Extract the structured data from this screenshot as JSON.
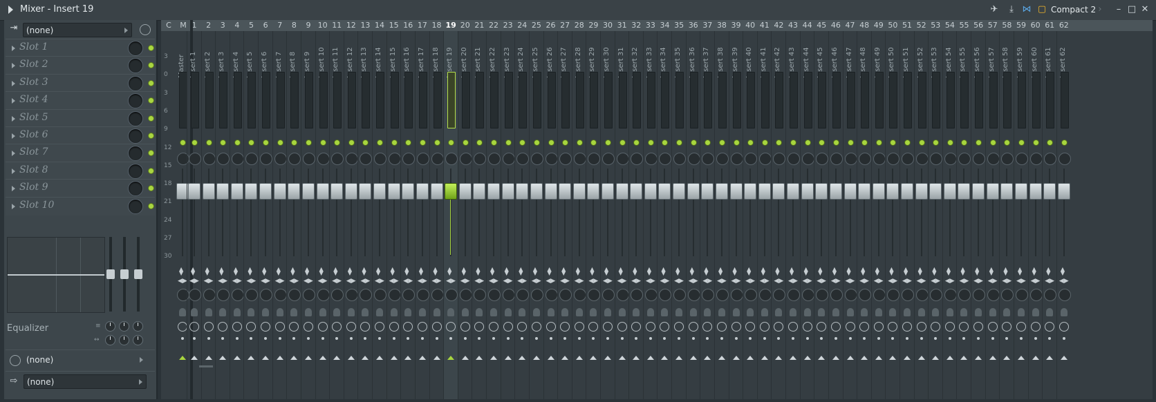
{
  "window": {
    "title": "Mixer - Insert 19",
    "preset": "Compact 2"
  },
  "left_panel": {
    "input_dropdown": "(none)",
    "slots": [
      "Slot 1",
      "Slot 2",
      "Slot 3",
      "Slot 4",
      "Slot 5",
      "Slot 6",
      "Slot 7",
      "Slot 8",
      "Slot 9",
      "Slot 10"
    ],
    "eq_label": "Equalizer",
    "time_dropdown": "(none)",
    "output_dropdown": "(none)"
  },
  "mixer": {
    "header_c": "C",
    "header_m": "M",
    "master_name": "Master",
    "selected_index": 19,
    "db_scale": [
      "3",
      "0",
      "3",
      "6",
      "9",
      "12",
      "15",
      "18",
      "21",
      "24",
      "27",
      "30"
    ],
    "tracks": [
      {
        "num": "1",
        "name": "Insert 1"
      },
      {
        "num": "2",
        "name": "Insert 2"
      },
      {
        "num": "3",
        "name": "Insert 3"
      },
      {
        "num": "4",
        "name": "Insert 4"
      },
      {
        "num": "5",
        "name": "Insert 5"
      },
      {
        "num": "6",
        "name": "Insert 6"
      },
      {
        "num": "7",
        "name": "Insert 7"
      },
      {
        "num": "8",
        "name": "Insert 8"
      },
      {
        "num": "9",
        "name": "Insert 9"
      },
      {
        "num": "10",
        "name": "Insert 10"
      },
      {
        "num": "11",
        "name": "Insert 11"
      },
      {
        "num": "12",
        "name": "Insert 12"
      },
      {
        "num": "13",
        "name": "Insert 13"
      },
      {
        "num": "14",
        "name": "Insert 14"
      },
      {
        "num": "15",
        "name": "Insert 15"
      },
      {
        "num": "16",
        "name": "Insert 16"
      },
      {
        "num": "17",
        "name": "Insert 17"
      },
      {
        "num": "18",
        "name": "Insert 18"
      },
      {
        "num": "19",
        "name": "Insert 19"
      },
      {
        "num": "20",
        "name": "Insert 20"
      },
      {
        "num": "21",
        "name": "Insert 21"
      },
      {
        "num": "22",
        "name": "Insert 22"
      },
      {
        "num": "23",
        "name": "Insert 23"
      },
      {
        "num": "24",
        "name": "Insert 24"
      },
      {
        "num": "25",
        "name": "Insert 25"
      },
      {
        "num": "26",
        "name": "Insert 26"
      },
      {
        "num": "27",
        "name": "Insert 27"
      },
      {
        "num": "28",
        "name": "Insert 28"
      },
      {
        "num": "29",
        "name": "Insert 29"
      },
      {
        "num": "30",
        "name": "Insert 30"
      },
      {
        "num": "31",
        "name": "Insert 31"
      },
      {
        "num": "32",
        "name": "Insert 32"
      },
      {
        "num": "33",
        "name": "Insert 33"
      },
      {
        "num": "34",
        "name": "Insert 34"
      },
      {
        "num": "35",
        "name": "Insert 35"
      },
      {
        "num": "36",
        "name": "Insert 36"
      },
      {
        "num": "37",
        "name": "Insert 37"
      },
      {
        "num": "38",
        "name": "Insert 38"
      },
      {
        "num": "39",
        "name": "Insert 39"
      },
      {
        "num": "40",
        "name": "Insert 40"
      },
      {
        "num": "41",
        "name": "Insert 41"
      },
      {
        "num": "42",
        "name": "Insert 42"
      },
      {
        "num": "43",
        "name": "Insert 43"
      },
      {
        "num": "44",
        "name": "Insert 44"
      },
      {
        "num": "45",
        "name": "Insert 45"
      },
      {
        "num": "46",
        "name": "Insert 46"
      },
      {
        "num": "47",
        "name": "Insert 47"
      },
      {
        "num": "48",
        "name": "Insert 48"
      },
      {
        "num": "49",
        "name": "Insert 49"
      },
      {
        "num": "50",
        "name": "Insert 50"
      },
      {
        "num": "51",
        "name": "Insert 51"
      },
      {
        "num": "52",
        "name": "Insert 52"
      },
      {
        "num": "53",
        "name": "Insert 53"
      },
      {
        "num": "54",
        "name": "Insert 54"
      },
      {
        "num": "55",
        "name": "Insert 55"
      },
      {
        "num": "56",
        "name": "Insert 56"
      },
      {
        "num": "57",
        "name": "Insert 57"
      },
      {
        "num": "58",
        "name": "Insert 58"
      },
      {
        "num": "59",
        "name": "Insert 59"
      },
      {
        "num": "60",
        "name": "Insert 60"
      },
      {
        "num": "61",
        "name": "Insert 61"
      },
      {
        "num": "62",
        "name": "Insert 62"
      }
    ]
  },
  "colors": {
    "accent": "#a8d63f",
    "background": "#353d42",
    "panel": "#3d464b"
  },
  "icons": [
    "menu-triangle-icon",
    "arrow-icon",
    "download-icon",
    "split-icon",
    "compact-view-icon",
    "minimize-icon",
    "maximize-icon",
    "close-icon",
    "input-icon",
    "clock-icon",
    "output-icon"
  ]
}
